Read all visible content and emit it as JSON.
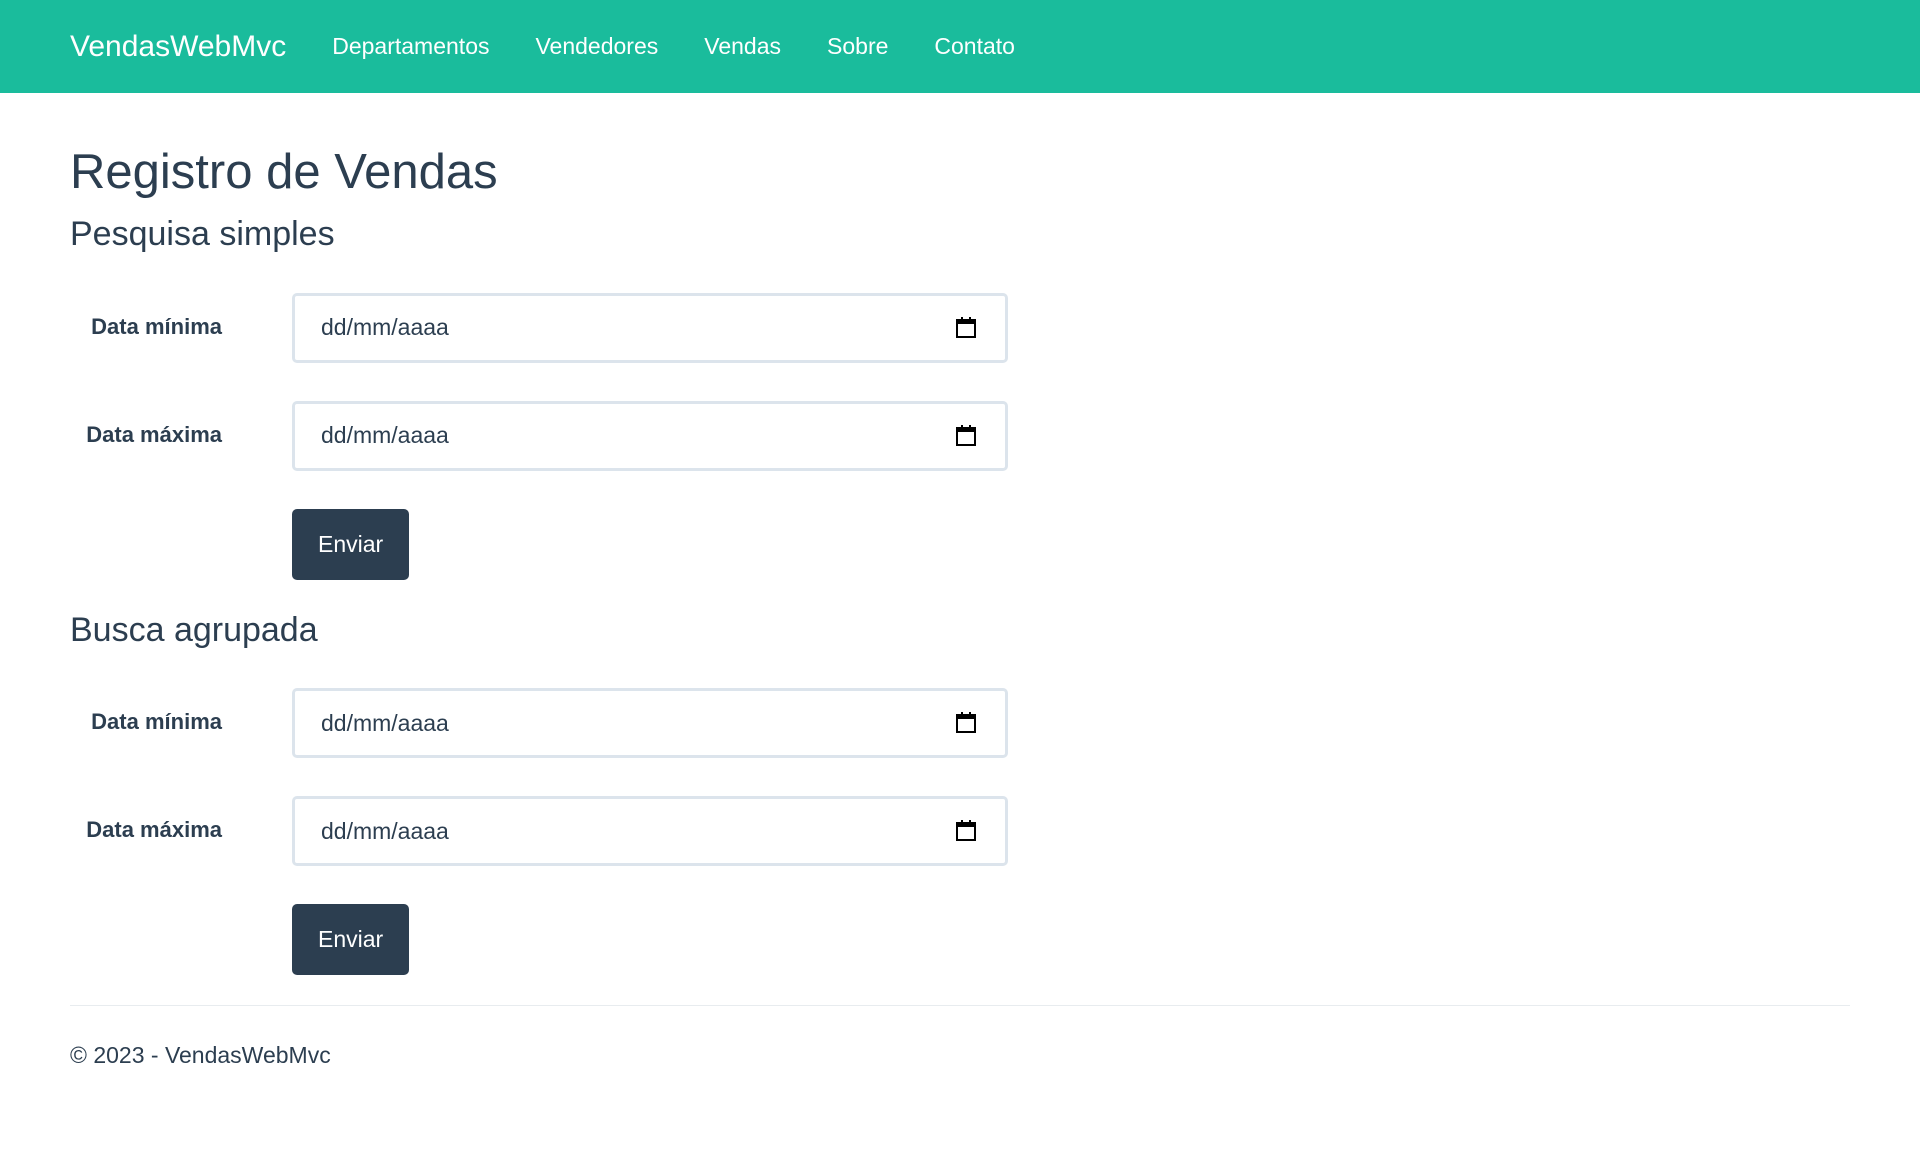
{
  "navbar": {
    "brand": "VendasWebMvc",
    "items": [
      {
        "label": "Departamentos"
      },
      {
        "label": "Vendedores"
      },
      {
        "label": "Vendas"
      },
      {
        "label": "Sobre"
      },
      {
        "label": "Contato"
      }
    ]
  },
  "page": {
    "title": "Registro de Vendas"
  },
  "simple_search": {
    "title": "Pesquisa simples",
    "min_date_label": "Data mínima",
    "min_date_placeholder": "dd/mm/aaaa",
    "max_date_label": "Data máxima",
    "max_date_placeholder": "dd/mm/aaaa",
    "submit_label": "Enviar"
  },
  "grouped_search": {
    "title": "Busca agrupada",
    "min_date_label": "Data mínima",
    "min_date_placeholder": "dd/mm/aaaa",
    "max_date_label": "Data máxima",
    "max_date_placeholder": "dd/mm/aaaa",
    "submit_label": "Enviar"
  },
  "footer": {
    "text": "© 2023 - VendasWebMvc"
  },
  "colors": {
    "navbar_bg": "#1abc9c",
    "primary_dark": "#2c3e50",
    "input_border": "#dce4ec"
  },
  "icons": {
    "date_picker": "calendar-icon"
  }
}
